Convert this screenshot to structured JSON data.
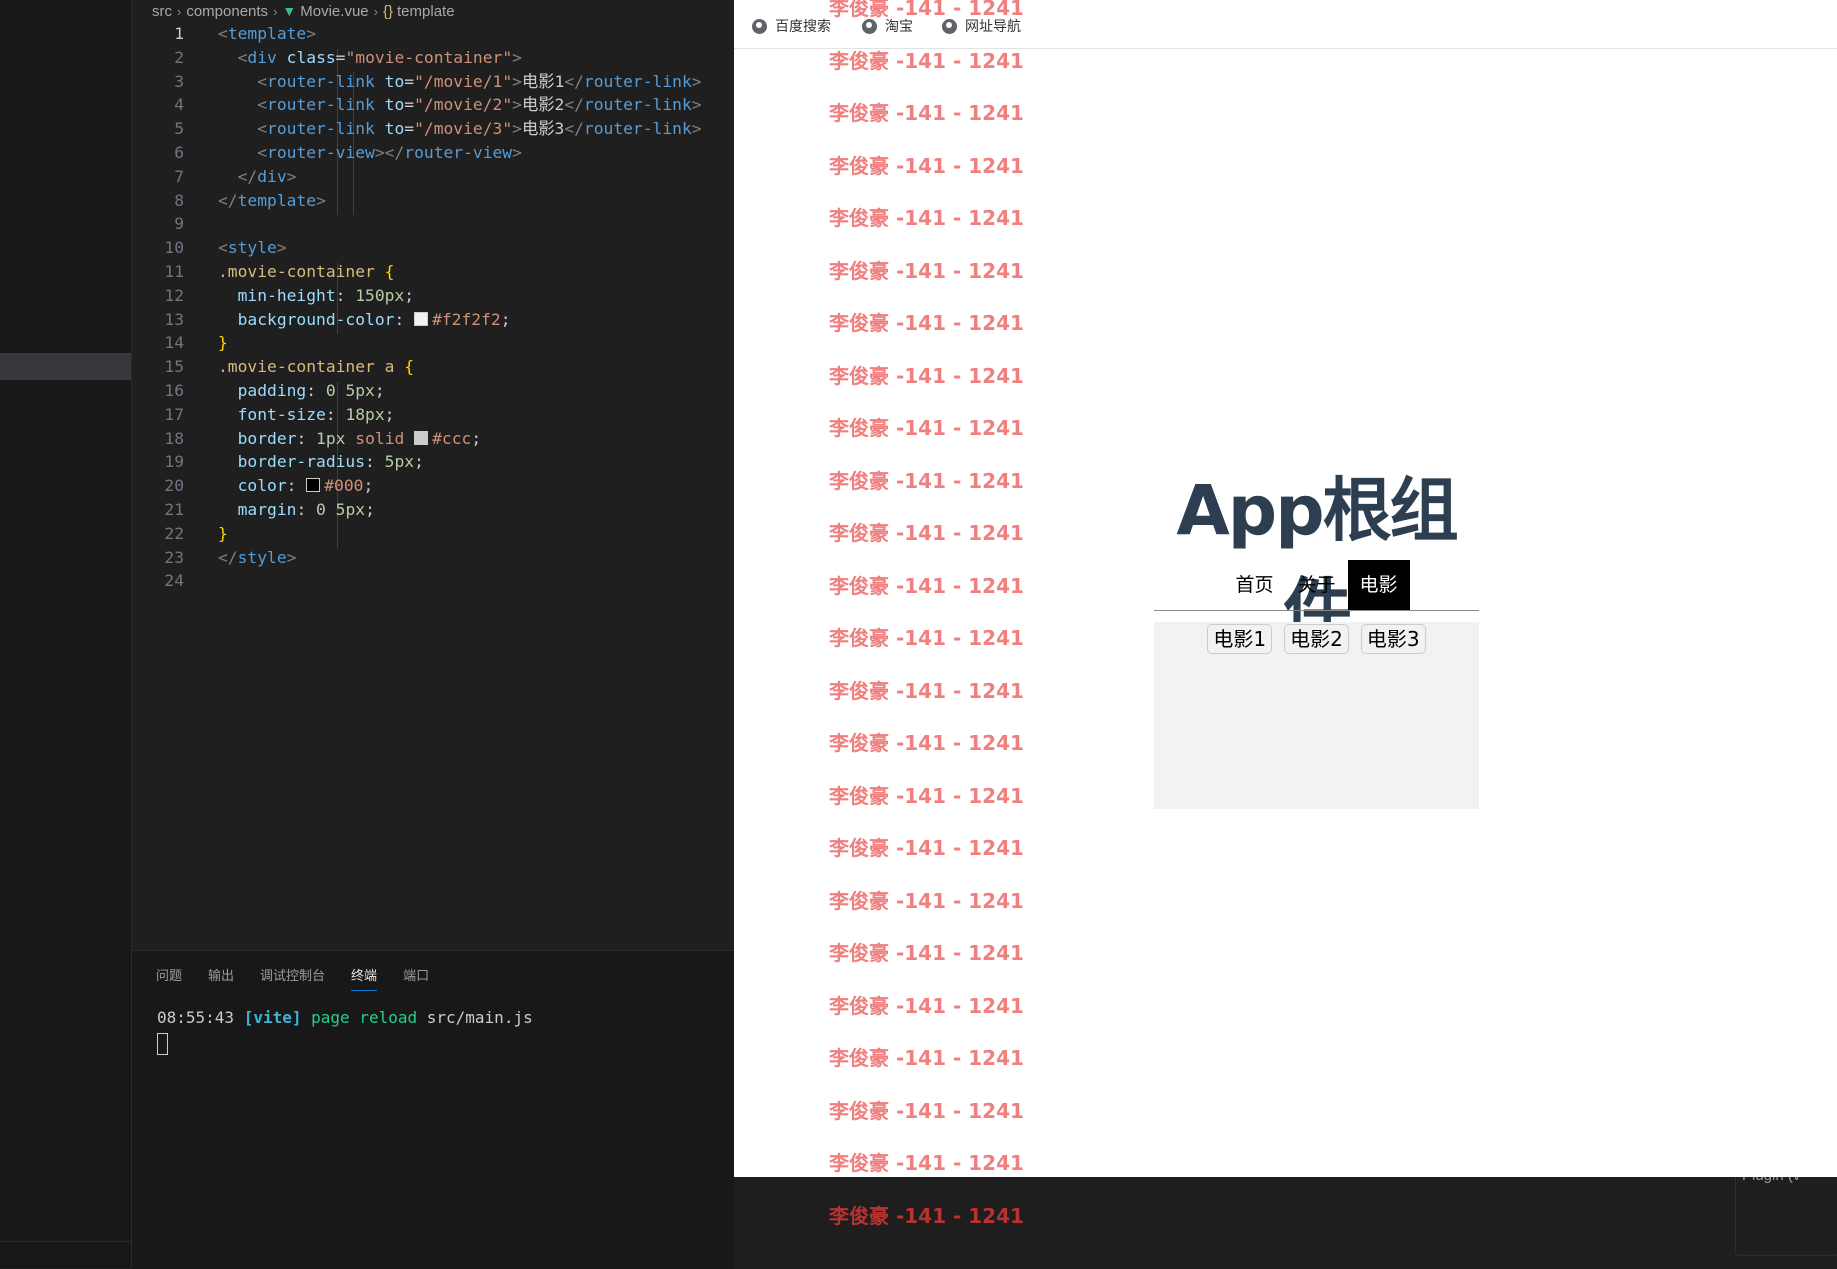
{
  "breadcrumb": [
    "src",
    "components",
    "Movie.vue",
    "template"
  ],
  "code_lines": [
    [
      {
        "c": "punct",
        "t": "<"
      },
      {
        "c": "tag",
        "t": "template"
      },
      {
        "c": "punct",
        "t": ">"
      }
    ],
    [
      {
        "c": "plain",
        "t": "  "
      },
      {
        "c": "punct",
        "t": "<"
      },
      {
        "c": "tag",
        "t": "div"
      },
      {
        "c": "plain",
        "t": " "
      },
      {
        "c": "attr",
        "t": "class"
      },
      {
        "c": "plain",
        "t": "="
      },
      {
        "c": "str",
        "t": "\"movie-container\""
      },
      {
        "c": "punct",
        "t": ">"
      }
    ],
    [
      {
        "c": "plain",
        "t": "    "
      },
      {
        "c": "punct",
        "t": "<"
      },
      {
        "c": "tag",
        "t": "router-link"
      },
      {
        "c": "plain",
        "t": " "
      },
      {
        "c": "attr",
        "t": "to"
      },
      {
        "c": "plain",
        "t": "="
      },
      {
        "c": "str",
        "t": "\"/movie/1\""
      },
      {
        "c": "punct",
        "t": ">"
      },
      {
        "c": "plain",
        "t": "电影1"
      },
      {
        "c": "punct",
        "t": "</"
      },
      {
        "c": "tag",
        "t": "router-link"
      },
      {
        "c": "punct",
        "t": ">"
      }
    ],
    [
      {
        "c": "plain",
        "t": "    "
      },
      {
        "c": "punct",
        "t": "<"
      },
      {
        "c": "tag",
        "t": "router-link"
      },
      {
        "c": "plain",
        "t": " "
      },
      {
        "c": "attr",
        "t": "to"
      },
      {
        "c": "plain",
        "t": "="
      },
      {
        "c": "str",
        "t": "\"/movie/2\""
      },
      {
        "c": "punct",
        "t": ">"
      },
      {
        "c": "plain",
        "t": "电影2"
      },
      {
        "c": "punct",
        "t": "</"
      },
      {
        "c": "tag",
        "t": "router-link"
      },
      {
        "c": "punct",
        "t": ">"
      }
    ],
    [
      {
        "c": "plain",
        "t": "    "
      },
      {
        "c": "punct",
        "t": "<"
      },
      {
        "c": "tag",
        "t": "router-link"
      },
      {
        "c": "plain",
        "t": " "
      },
      {
        "c": "attr",
        "t": "to"
      },
      {
        "c": "plain",
        "t": "="
      },
      {
        "c": "str",
        "t": "\"/movie/3\""
      },
      {
        "c": "punct",
        "t": ">"
      },
      {
        "c": "plain",
        "t": "电影3"
      },
      {
        "c": "punct",
        "t": "</"
      },
      {
        "c": "tag",
        "t": "router-link"
      },
      {
        "c": "punct",
        "t": ">"
      }
    ],
    [
      {
        "c": "plain",
        "t": "    "
      },
      {
        "c": "punct",
        "t": "<"
      },
      {
        "c": "tag",
        "t": "router-view"
      },
      {
        "c": "punct",
        "t": "></"
      },
      {
        "c": "tag",
        "t": "router-view"
      },
      {
        "c": "punct",
        "t": ">"
      }
    ],
    [
      {
        "c": "plain",
        "t": "  "
      },
      {
        "c": "punct",
        "t": "</"
      },
      {
        "c": "tag",
        "t": "div"
      },
      {
        "c": "punct",
        "t": ">"
      }
    ],
    [
      {
        "c": "punct",
        "t": "</"
      },
      {
        "c": "tag",
        "t": "template"
      },
      {
        "c": "punct",
        "t": ">"
      }
    ],
    [],
    [
      {
        "c": "punct",
        "t": "<"
      },
      {
        "c": "tag",
        "t": "style"
      },
      {
        "c": "punct",
        "t": ">"
      }
    ],
    [
      {
        "c": "sel-c",
        "t": ".movie-container"
      },
      {
        "c": "plain",
        "t": " "
      },
      {
        "c": "brace",
        "t": "{"
      }
    ],
    [
      {
        "c": "plain",
        "t": "  "
      },
      {
        "c": "prop",
        "t": "min-height"
      },
      {
        "c": "plain",
        "t": ": "
      },
      {
        "c": "num",
        "t": "150px"
      },
      {
        "c": "plain",
        "t": ";"
      }
    ],
    [
      {
        "c": "plain",
        "t": "  "
      },
      {
        "c": "prop",
        "t": "background-color"
      },
      {
        "c": "plain",
        "t": ": "
      },
      {
        "c": "swatch",
        "t": "#f2f2f2"
      },
      {
        "c": "str",
        "t": "#f2f2f2"
      },
      {
        "c": "plain",
        "t": ";"
      }
    ],
    [
      {
        "c": "brace",
        "t": "}"
      }
    ],
    [
      {
        "c": "sel-c",
        "t": ".movie-container a"
      },
      {
        "c": "plain",
        "t": " "
      },
      {
        "c": "brace",
        "t": "{"
      }
    ],
    [
      {
        "c": "plain",
        "t": "  "
      },
      {
        "c": "prop",
        "t": "padding"
      },
      {
        "c": "plain",
        "t": ": "
      },
      {
        "c": "num",
        "t": "0 5px"
      },
      {
        "c": "plain",
        "t": ";"
      }
    ],
    [
      {
        "c": "plain",
        "t": "  "
      },
      {
        "c": "prop",
        "t": "font-size"
      },
      {
        "c": "plain",
        "t": ": "
      },
      {
        "c": "num",
        "t": "18px"
      },
      {
        "c": "plain",
        "t": ";"
      }
    ],
    [
      {
        "c": "plain",
        "t": "  "
      },
      {
        "c": "prop",
        "t": "border"
      },
      {
        "c": "plain",
        "t": ": "
      },
      {
        "c": "num",
        "t": "1px"
      },
      {
        "c": "plain",
        "t": " "
      },
      {
        "c": "str",
        "t": "solid"
      },
      {
        "c": "plain",
        "t": " "
      },
      {
        "c": "swatch",
        "t": "#cccccc"
      },
      {
        "c": "str",
        "t": "#ccc"
      },
      {
        "c": "plain",
        "t": ";"
      }
    ],
    [
      {
        "c": "plain",
        "t": "  "
      },
      {
        "c": "prop",
        "t": "border-radius"
      },
      {
        "c": "plain",
        "t": ": "
      },
      {
        "c": "num",
        "t": "5px"
      },
      {
        "c": "plain",
        "t": ";"
      }
    ],
    [
      {
        "c": "plain",
        "t": "  "
      },
      {
        "c": "prop",
        "t": "color"
      },
      {
        "c": "plain",
        "t": ": "
      },
      {
        "c": "swatch",
        "t": "#000000"
      },
      {
        "c": "str",
        "t": "#000"
      },
      {
        "c": "plain",
        "t": ";"
      }
    ],
    [
      {
        "c": "plain",
        "t": "  "
      },
      {
        "c": "prop",
        "t": "margin"
      },
      {
        "c": "plain",
        "t": ": "
      },
      {
        "c": "num",
        "t": "0 5px"
      },
      {
        "c": "plain",
        "t": ";"
      }
    ],
    [
      {
        "c": "brace",
        "t": "}"
      }
    ],
    [
      {
        "c": "punct",
        "t": "</"
      },
      {
        "c": "tag",
        "t": "style"
      },
      {
        "c": "punct",
        "t": ">"
      }
    ],
    []
  ],
  "panel": {
    "tabs": [
      "问题",
      "输出",
      "调试控制台",
      "终端",
      "端口"
    ],
    "active_tab": "终端"
  },
  "terminal": {
    "time": "08:55:43",
    "tag": "[vite]",
    "msg": "page reload",
    "file": "src/main.js"
  },
  "browser": {
    "bookmarks": [
      "百度搜索",
      "淘宝",
      "网址导航"
    ],
    "app_title": "App根组件",
    "nav": [
      "首页",
      "关于",
      "电影"
    ],
    "nav_active": "电影",
    "movie_links": [
      "电影1",
      "电影2",
      "电影3"
    ]
  },
  "watermark": "李俊豪 -141 - 1241",
  "popup_text": "Plugin (v"
}
